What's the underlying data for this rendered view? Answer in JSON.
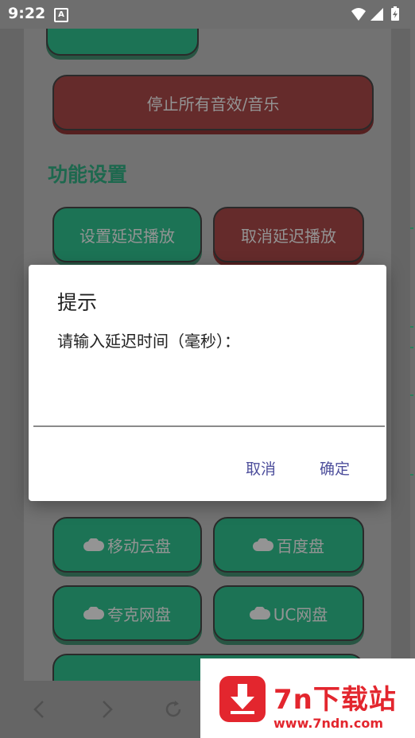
{
  "status": {
    "time": "9:22",
    "notif_icon": "A"
  },
  "buttons": {
    "stop_all": "停止所有音效/音乐",
    "set_delay": "设置延迟播放",
    "cancel_delay": "取消延迟播放",
    "cloud_mobile": "移动云盘",
    "cloud_baidu": "百度盘",
    "cloud_quark": "夸克网盘",
    "cloud_uc": "UC网盘"
  },
  "section": {
    "feature_settings": "功能设置"
  },
  "dialog": {
    "title": "提示",
    "message": "请输入延迟时间（毫秒）：",
    "input_value": "",
    "cancel": "取消",
    "confirm": "确定"
  },
  "watermark": {
    "brand": "7n下载站",
    "site": "www.7ndn.com"
  },
  "colors": {
    "green_button": "#1e7a5a",
    "red_button": "#6b2e2e",
    "dialog_action": "#4e4f9c",
    "brand_red": "#e3262e"
  }
}
